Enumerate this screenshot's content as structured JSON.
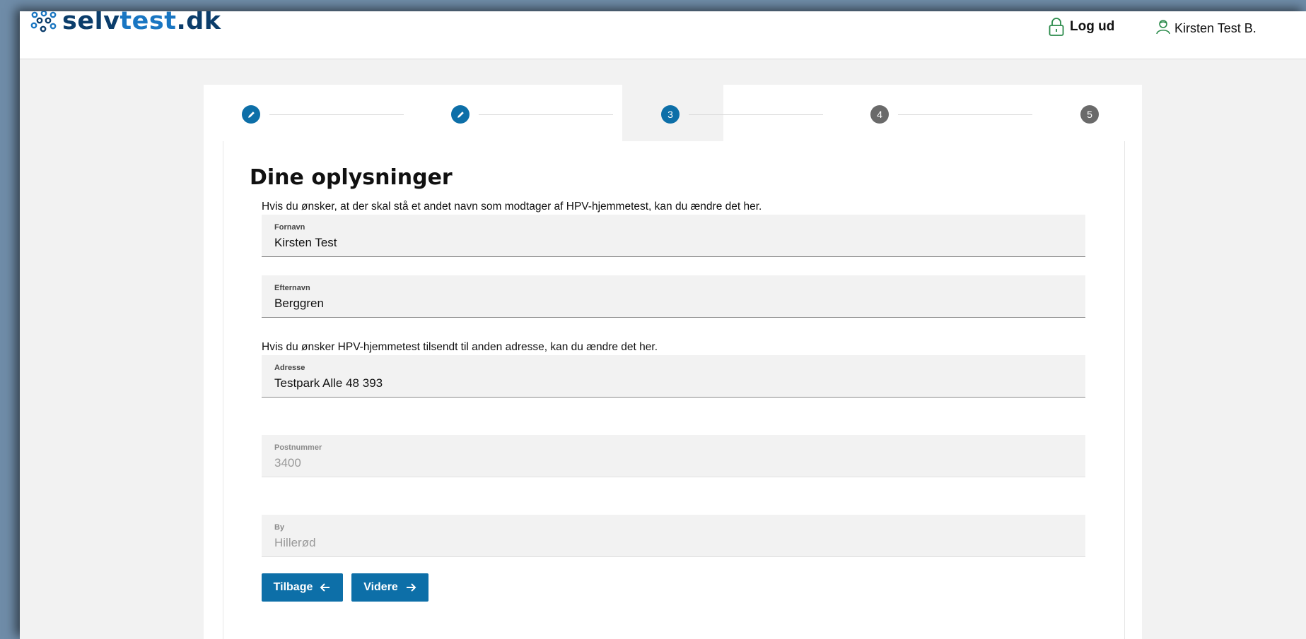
{
  "header": {
    "logo": {
      "part1": "selv",
      "part2": "test",
      "part3": ".dk"
    },
    "logout_label": "Log ud",
    "user_name": "Kirsten Test B."
  },
  "stepper": {
    "steps": [
      {
        "label": "",
        "state": "done"
      },
      {
        "label": "",
        "state": "done"
      },
      {
        "label": "3",
        "state": "active"
      },
      {
        "label": "4",
        "state": "todo"
      },
      {
        "label": "5",
        "state": "todo"
      }
    ]
  },
  "form": {
    "title": "Dine oplysninger",
    "name_hint": "Hvis du ønsker, at der skal stå et andet navn som modtager af HPV-hjemmetest, kan du ændre det her.",
    "address_hint": "Hvis du ønsker HPV-hjemmetest tilsendt til anden adresse, kan du ændre det her.",
    "fields": {
      "fornavn": {
        "label": "Fornavn",
        "value": "Kirsten Test"
      },
      "efternavn": {
        "label": "Efternavn",
        "value": "Berggren"
      },
      "adresse": {
        "label": "Adresse",
        "value": "Testpark Alle 48 393"
      },
      "postnummer": {
        "label": "Postnummer",
        "value": "3400"
      },
      "by": {
        "label": "By",
        "value": "Hillerød"
      }
    },
    "back_label": "Tilbage",
    "next_label": "Videre"
  },
  "colors": {
    "primary": "#0d6fa8",
    "step_inactive": "#6a6a6a",
    "logo_dark": "#0b3d6b",
    "logo_light": "#1976c2"
  },
  "icons": {
    "logout": "lock-icon",
    "user": "user-icon",
    "step_done": "pencil-icon",
    "back": "arrow-left-icon",
    "next": "arrow-right-icon"
  }
}
